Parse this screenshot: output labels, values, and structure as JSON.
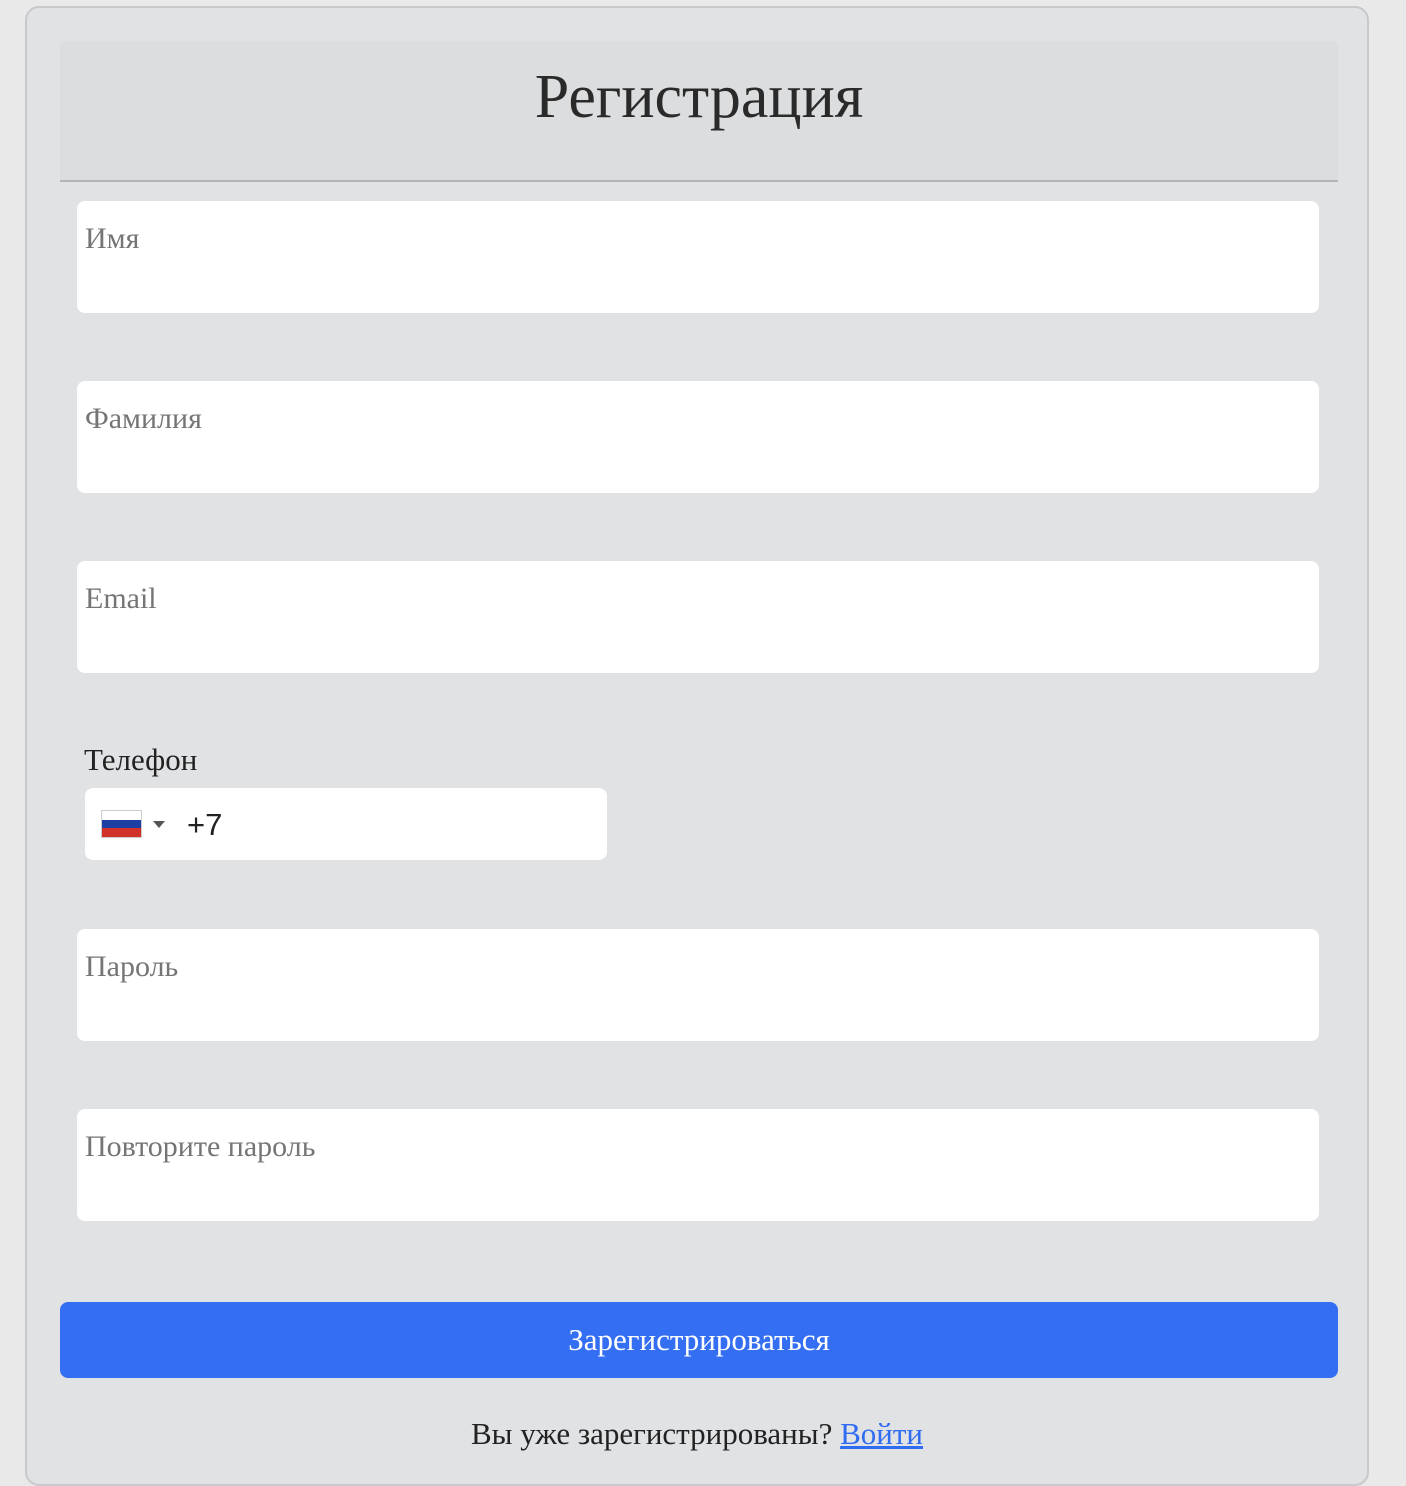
{
  "form": {
    "title": "Регистрация",
    "fields": {
      "first_name": {
        "placeholder": "Имя",
        "value": ""
      },
      "last_name": {
        "placeholder": "Фамилия",
        "value": ""
      },
      "email": {
        "placeholder": "Email",
        "value": ""
      },
      "password": {
        "placeholder": "Пароль",
        "value": ""
      },
      "password_repeat": {
        "placeholder": "Повторите пароль",
        "value": ""
      }
    },
    "phone": {
      "label": "Телефон",
      "country_flag": "russia-flag-icon",
      "value": "+7"
    },
    "submit_label": "Зарегистрироваться",
    "login_prompt": "Вы уже зарегистрированы?",
    "login_link": "Войти"
  }
}
